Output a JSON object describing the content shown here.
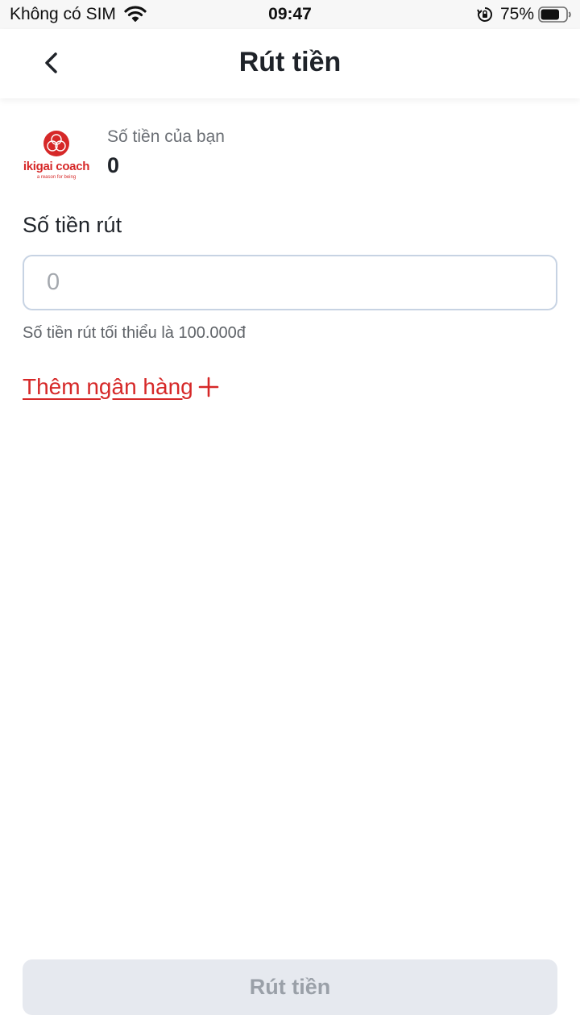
{
  "status_bar": {
    "carrier": "Không có SIM",
    "time": "09:47",
    "battery_percent": "75%",
    "battery_level": 0.75
  },
  "header": {
    "title": "Rút tiền",
    "back_icon": "chevron-left-icon"
  },
  "balance": {
    "logo_text": "ikigai coach",
    "logo_tagline": "a reason for being",
    "label": "Số tiền của bạn",
    "value": "0"
  },
  "withdraw": {
    "label": "Số tiền rút",
    "placeholder": "0",
    "value": "",
    "hint": "Số tiền rút tối thiểu là 100.000đ"
  },
  "add_bank": {
    "label": "Thêm ngân hàng",
    "icon": "plus-icon"
  },
  "footer": {
    "submit_label": "Rút tiền",
    "submit_enabled": false
  },
  "colors": {
    "accent": "#d62828",
    "input_border": "#c7d3e3",
    "disabled_bg": "#e6e9ef",
    "disabled_text": "#9aa0a8"
  }
}
